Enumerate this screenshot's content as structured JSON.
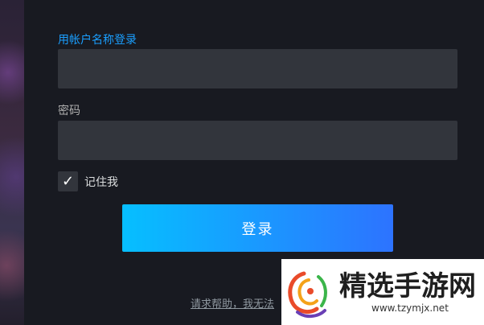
{
  "login": {
    "username_label": "用帐户名称登录",
    "password_label": "密码",
    "username_value": "",
    "password_value": "",
    "remember_me_label": "记住我",
    "remember_me_checked": true,
    "checkmark": "✓",
    "submit_label": "登录",
    "help_link": "请求帮助，我无法"
  },
  "colors": {
    "accent": "#1a9fff",
    "button_gradient_start": "#06bfff",
    "button_gradient_end": "#2d73ff",
    "field_bg": "#32353c",
    "page_bg": "#181a21"
  },
  "watermark": {
    "title": "精选手游网",
    "url": "www.tzymjx.net",
    "logo_icon": "swirl-logo-icon"
  }
}
